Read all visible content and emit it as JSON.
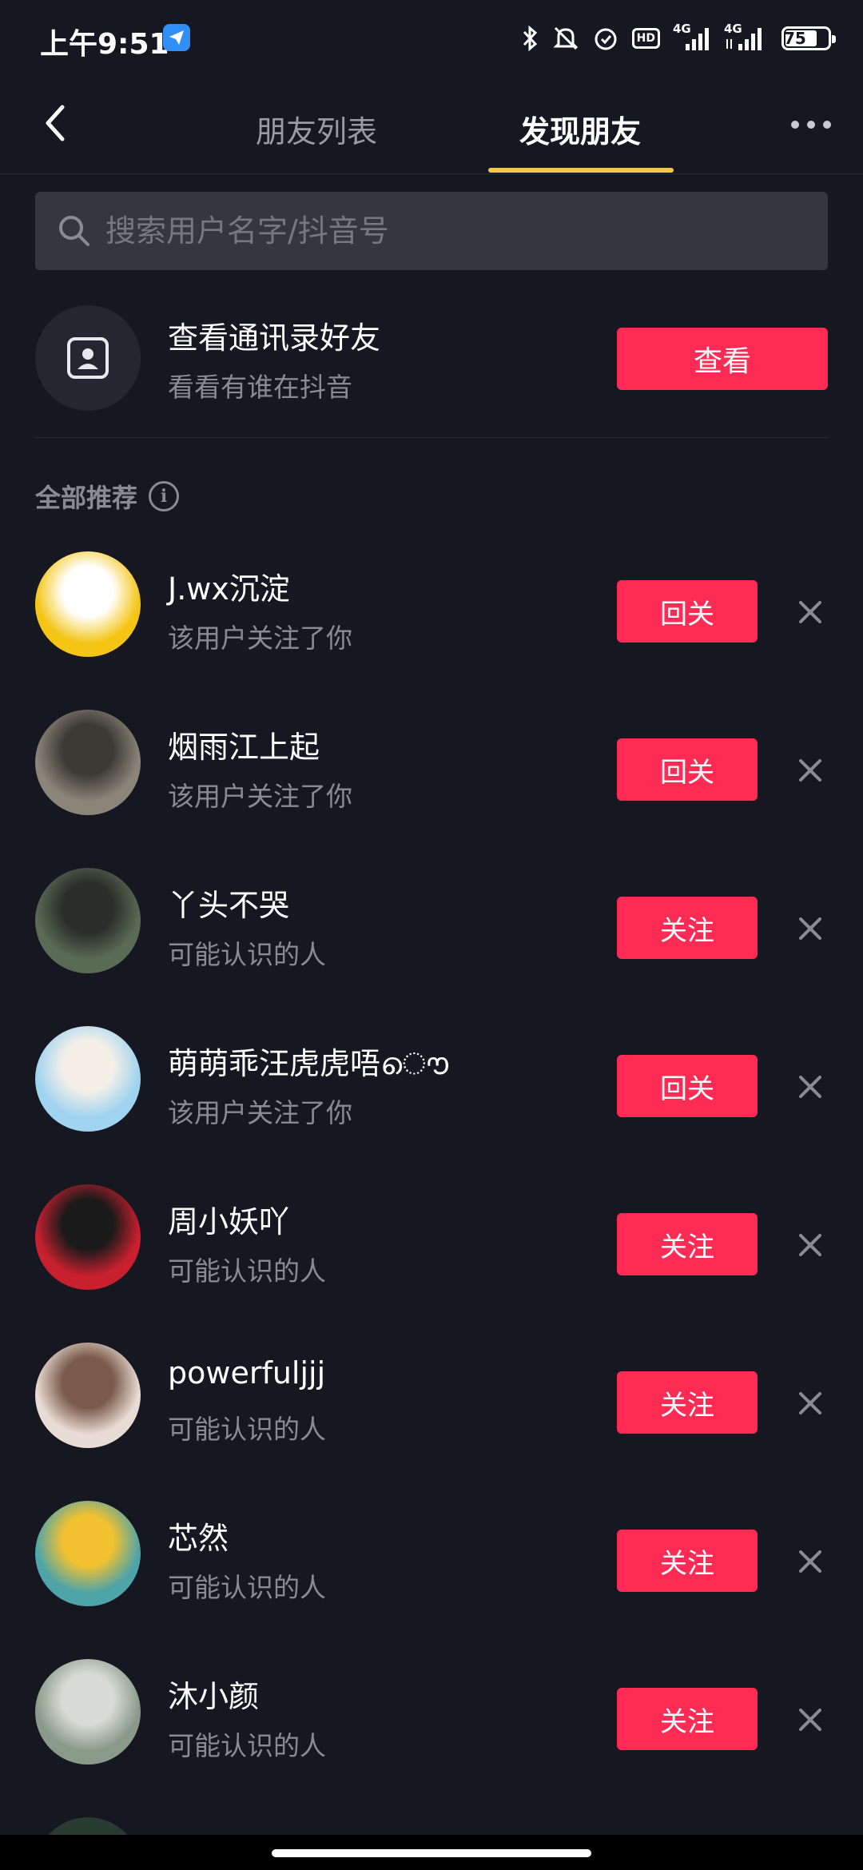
{
  "status_bar": {
    "time": "上午9:51",
    "battery": "75",
    "net1": "4G",
    "net2": "4G",
    "hd": "HD"
  },
  "header": {
    "tabs": [
      {
        "label": "朋友列表",
        "active": false
      },
      {
        "label": "发现朋友",
        "active": true
      }
    ],
    "accent_color": "#f6c744"
  },
  "search": {
    "placeholder": "搜索用户名字/抖音号"
  },
  "contacts": {
    "title": "查看通讯录好友",
    "subtitle": "看看有谁在抖音",
    "button": "查看"
  },
  "section": {
    "title": "全部推荐",
    "info_icon": "info-icon"
  },
  "users": [
    {
      "name": "J.wx沉淀",
      "sub": "该用户关注了你",
      "button": "回关",
      "avatar_colors": [
        "#f4c515",
        "#ffffff"
      ]
    },
    {
      "name": "烟雨江上起",
      "sub": "该用户关注了你",
      "button": "回关",
      "avatar_colors": [
        "#8b8579",
        "#3d3a36"
      ]
    },
    {
      "name": "丫头不哭",
      "sub": "可能认识的人",
      "button": "关注",
      "avatar_colors": [
        "#5a6b55",
        "#2a2e2a"
      ]
    },
    {
      "name": "萌萌乖汪虎虎唔ൌ",
      "sub": "该用户关注了你",
      "button": "回关",
      "avatar_colors": [
        "#9fd3f0",
        "#f4f0e8"
      ]
    },
    {
      "name": "周小妖吖",
      "sub": "可能认识的人",
      "button": "关注",
      "avatar_colors": [
        "#c8202e",
        "#1a1a1a"
      ]
    },
    {
      "name": "powerfuljjj",
      "sub": "可能认识的人",
      "button": "关注",
      "avatar_colors": [
        "#e9dcd4",
        "#7a5a4a"
      ]
    },
    {
      "name": "芯然",
      "sub": "可能认识的人",
      "button": "关注",
      "avatar_colors": [
        "#4fa4a8",
        "#f2c230"
      ]
    },
    {
      "name": "沐小颜",
      "sub": "可能认识的人",
      "button": "关注",
      "avatar_colors": [
        "#8a9a8a",
        "#d9dcd6"
      ]
    }
  ],
  "colors": {
    "background": "#171722",
    "primary_button": "#fe2c55",
    "secondary_text": "#8a8a94"
  }
}
